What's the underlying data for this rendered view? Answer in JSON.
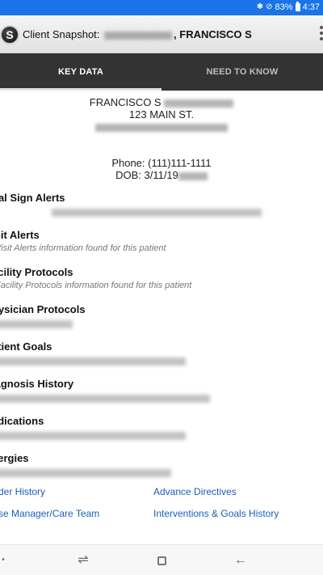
{
  "status_bar": {
    "icons": [
      "mute-icon",
      "signal-icon"
    ],
    "battery_percent": "83%",
    "time": "4:37"
  },
  "app_bar": {
    "logo_letter": "S",
    "title_prefix": "Client Snapshot:",
    "patient_name": ", FRANCISCO S"
  },
  "tabs": [
    {
      "label": "KEY DATA",
      "active": true
    },
    {
      "label": "NEED TO KNOW",
      "active": false
    }
  ],
  "patient": {
    "name": "FRANCISCO S",
    "address_line1": "123 MAIN ST.",
    "phone": "Phone: (111)111-1111",
    "dob": "DOB: 3/11/19"
  },
  "sections": [
    {
      "title": "ital Sign Alerts",
      "subtitle": null
    },
    {
      "title": "isit Alerts",
      "subtitle": "Visit Alerts information found for this patient"
    },
    {
      "title": "acility Protocols",
      "subtitle": "Facility Protocols information found for this patient"
    },
    {
      "title": "hysician Protocols",
      "subtitle": null
    },
    {
      "title": "atient Goals",
      "subtitle": null
    },
    {
      "title": "iagnosis History",
      "subtitle": null
    },
    {
      "title": "edications",
      "subtitle": null
    },
    {
      "title": "llergies",
      "subtitle": null
    }
  ],
  "links": {
    "order_history": "der History",
    "advance_directives": "Advance Directives",
    "case_manager": "se Manager/Care Team",
    "interventions": "Interventions & Goals History"
  },
  "nav_bar": {
    "back_glyph": "←",
    "home_glyph": "□",
    "recents_glyph": "⇌"
  }
}
